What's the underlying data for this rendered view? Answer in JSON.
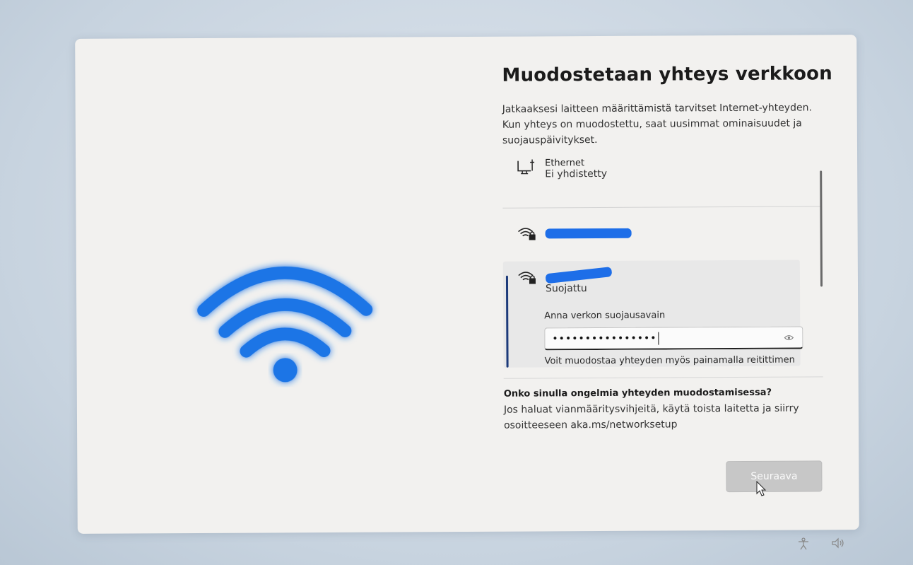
{
  "page": {
    "title": "Muodostetaan yhteys verkkoon",
    "description": "Jatkaaksesi laitteen määrittämistä tarvitset Internet-yhteyden. Kun yhteys on muodostettu, saat uusimmat ominaisuudet ja suojauspäivitykset."
  },
  "networks": {
    "ethernet": {
      "name": "Ethernet",
      "status": "Ei yhdistetty",
      "icon": "ethernet-icon"
    },
    "wifi_1": {
      "icon": "wifi-lock-icon"
    },
    "wifi_selected": {
      "icon": "wifi-lock-icon",
      "status": "Suojattu",
      "password_label": "Anna verkon suojausavain",
      "password_value": "••••••••••••••••",
      "hint": "Voit muodostaa yhteyden myös painamalla reitittimen"
    }
  },
  "help": {
    "title": "Onko sinulla ongelmia yhteyden muodostamisessa?",
    "text": "Jos haluat vianmääritysvihjeitä, käytä toista laitetta ja siirry osoitteeseen aka.ms/networksetup"
  },
  "buttons": {
    "next": "Seuraava"
  },
  "colors": {
    "accent": "#1e6ee8",
    "selected_bar": "#1c3a7a",
    "button_disabled": "#c7c7c7"
  }
}
